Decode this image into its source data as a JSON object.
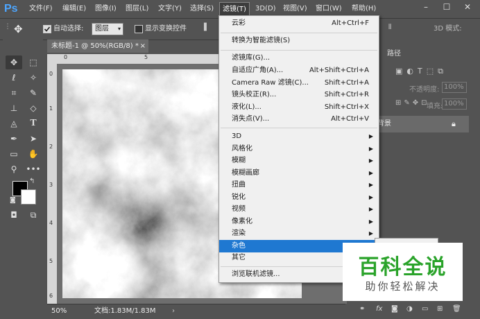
{
  "app": {
    "logo": "Ps"
  },
  "menubar": {
    "items": [
      "文件(F)",
      "编辑(E)",
      "图像(I)",
      "图层(L)",
      "文字(Y)",
      "选择(S)",
      "滤镜(T)",
      "3D(D)",
      "视图(V)",
      "窗口(W)",
      "帮助(H)"
    ],
    "active_index": 6,
    "minimize": "–",
    "maximize": "☐",
    "close": "✕"
  },
  "options_bar": {
    "move_icon": "move-icon",
    "auto_select_label": "自动选择:",
    "auto_select_checked": true,
    "auto_select_value": "图层",
    "show_transform_label": "显示变换控件",
    "show_transform_checked": false,
    "mode_3d_label": "3D 模式:"
  },
  "document": {
    "tab_title": "未标题-1 @ 50%(RGB/8) *",
    "tab_close": "×",
    "zoom": "50%",
    "doc_info": "文档:1.83M/1.83M",
    "ruler_top": [
      "0",
      "5"
    ],
    "ruler_left": [
      "0",
      "1",
      "2",
      "3",
      "4",
      "5",
      "6"
    ]
  },
  "filter_menu": {
    "items": [
      {
        "label": "云彩",
        "shortcut": "Alt+Ctrl+F"
      },
      {
        "label": "转换为智能滤镜(S)",
        "shortcut": ""
      },
      {
        "label": "滤镜库(G)...",
        "shortcut": ""
      },
      {
        "label": "自适应广角(A)...",
        "shortcut": "Alt+Shift+Ctrl+A"
      },
      {
        "label": "Camera Raw 滤镜(C)...",
        "shortcut": "Shift+Ctrl+A"
      },
      {
        "label": "镜头校正(R)...",
        "shortcut": "Shift+Ctrl+R"
      },
      {
        "label": "液化(L)...",
        "shortcut": "Shift+Ctrl+X"
      },
      {
        "label": "消失点(V)...",
        "shortcut": "Alt+Ctrl+V"
      },
      {
        "label": "3D",
        "shortcut": ""
      },
      {
        "label": "风格化",
        "shortcut": ""
      },
      {
        "label": "模糊",
        "shortcut": ""
      },
      {
        "label": "模糊画廊",
        "shortcut": ""
      },
      {
        "label": "扭曲",
        "shortcut": ""
      },
      {
        "label": "锐化",
        "shortcut": ""
      },
      {
        "label": "视频",
        "shortcut": ""
      },
      {
        "label": "像素化",
        "shortcut": ""
      },
      {
        "label": "渲染",
        "shortcut": ""
      },
      {
        "label": "杂色",
        "shortcut": ""
      },
      {
        "label": "其它",
        "shortcut": ""
      },
      {
        "label": "浏览联机滤镜...",
        "shortcut": ""
      }
    ],
    "submenu_arrow": "▶",
    "highlighted_index": 17
  },
  "right_panel": {
    "tab_paths": "路径",
    "opacity_label": "不透明度:",
    "opacity_value": "100%",
    "fill_label": "填充:",
    "fill_value": "100%",
    "layer_name": "背景",
    "lock_icon": "lock-icon"
  },
  "watermark": {
    "title": "百科全说",
    "subtitle": "助你轻松解决"
  },
  "colors": {
    "ui_bg": "#535353",
    "menu_bg": "#f0f0f0",
    "highlight": "#1f78d1",
    "watermark_green": "#2aa32a",
    "ps_blue": "#4da6ff"
  }
}
